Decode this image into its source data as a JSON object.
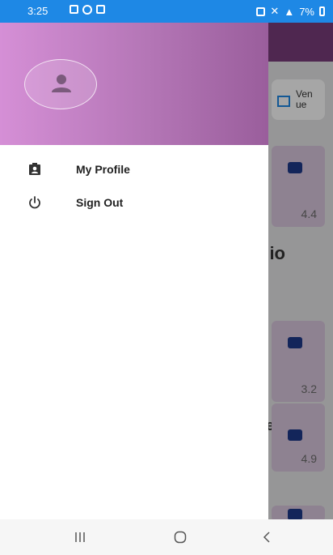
{
  "status_bar": {
    "time": "3:25",
    "battery_percent": "7%"
  },
  "background": {
    "chip_label": "Ven\nue",
    "cards": [
      {
        "rating": "4.4"
      },
      {
        "rating": "3.2"
      },
      {
        "rating": "4.9"
      }
    ],
    "partial_text_1": "dio",
    "partial_text_2": "e"
  },
  "drawer": {
    "menu": [
      {
        "label": "My Profile",
        "icon": "profile-badge-icon"
      },
      {
        "label": "Sign Out",
        "icon": "power-icon"
      }
    ]
  },
  "colors": {
    "drawer_header_gradient_start": "#d58fd6",
    "drawer_header_gradient_end": "#9a5e9c",
    "status_bar": "#1e88e5",
    "toolbar": "#7a3c7b"
  }
}
